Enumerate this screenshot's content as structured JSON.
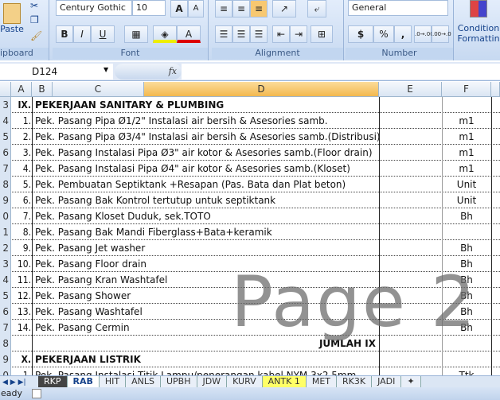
{
  "ribbon": {
    "clipboard": {
      "paste": "Paste",
      "label": "ipboard"
    },
    "font": {
      "name": "Century Gothic",
      "size": "10",
      "bold": "B",
      "italic": "I",
      "underline": "U",
      "grow": "A",
      "shrink": "A",
      "color": "A",
      "label": "Font"
    },
    "alignment": {
      "label": "Alignment"
    },
    "number": {
      "format": "General",
      "currency": "$",
      "percent": "%",
      "comma": ",",
      "inc": ".0→.00",
      "dec": ".00→.0",
      "label": "Number"
    },
    "styles": {
      "conditional": "Condition",
      "formatting": "Formattin"
    }
  },
  "formula_bar": {
    "name_box": "D124",
    "fx": "fx",
    "value": ""
  },
  "columns": [
    "A",
    "B",
    "C",
    "D",
    "E",
    "F"
  ],
  "rows": [
    {
      "rn": "3",
      "num": "IX.",
      "text": "PEKERJAAN SANITARY & PLUMBING",
      "unit": "",
      "bold": true
    },
    {
      "rn": "4",
      "num": "1.",
      "text": "Pek. Pasang Pipa Ø1/2\" Instalasi air bersih & Asesories samb.",
      "unit": "m1"
    },
    {
      "rn": "5",
      "num": "2.",
      "text": "Pek. Pasang Pipa Ø3/4\" Instalasi air bersih & Asesories samb.(Distribusi)",
      "unit": "m1"
    },
    {
      "rn": "6",
      "num": "3.",
      "text": "Pek. Pasang  Instalasi Pipa Ø3\" air kotor & Asesories samb.(Floor drain)",
      "unit": "m1"
    },
    {
      "rn": "7",
      "num": "4.",
      "text": "Pek. Pasang  Instalasi Pipa Ø4\" air kotor & Asesories samb.(Kloset)",
      "unit": "m1"
    },
    {
      "rn": "8",
      "num": "5.",
      "text": "Pek. Pembuatan Septiktank +Resapan (Pas. Bata dan Plat beton)",
      "unit": "Unit"
    },
    {
      "rn": "9",
      "num": "6.",
      "text": "Pek. Pasang  Bak Kontrol tertutup untuk septiktank",
      "unit": "Unit"
    },
    {
      "rn": "0",
      "num": "7.",
      "text": "Pek. Pasang Kloset Duduk, sek.TOTO",
      "unit": "Bh"
    },
    {
      "rn": "1",
      "num": "8.",
      "text": "Pek. Pasang  Bak Mandi Fiberglass+Bata+keramik",
      "unit": ""
    },
    {
      "rn": "2",
      "num": "9.",
      "text": "Pek. Pasang Jet washer",
      "unit": "Bh"
    },
    {
      "rn": "3",
      "num": "10.",
      "text": "Pek. Pasang Floor drain",
      "unit": "Bh"
    },
    {
      "rn": "4",
      "num": "11.",
      "text": "Pek. Pasang Kran Washtafel",
      "unit": "Bh"
    },
    {
      "rn": "5",
      "num": "12.",
      "text": "Pek. Pasang Shower",
      "unit": "Bh"
    },
    {
      "rn": "6",
      "num": "13.",
      "text": "Pek. Pasang Washtafel",
      "unit": "Bh"
    },
    {
      "rn": "7",
      "num": "14.",
      "text": "Pek. Pasang Cermin",
      "unit": "Bh"
    },
    {
      "rn": "8",
      "num": "",
      "text": "JUMLAH IX",
      "unit": "",
      "total": true
    },
    {
      "rn": "9",
      "num": "X.",
      "text": "PEKERJAAN LISTRIK",
      "unit": "",
      "bold": true
    },
    {
      "rn": "0",
      "num": "1.",
      "text": "Pek. Pasang Instalasi Titik Lampu/penerangan kabel NYM 3x2.5mm",
      "unit": "Ttk"
    }
  ],
  "watermark": "Page 2",
  "sheet_tabs": [
    "RKP",
    "RAB",
    "HIT",
    "ANLS",
    "UPBH",
    "JDW",
    "KURV",
    "ANTK 1",
    "MET",
    "RK3K",
    "JADI"
  ],
  "active_tab": "RAB",
  "status": "eady",
  "colors": {
    "selected_col": "#f8c870",
    "tab_highlight": "#ffff66",
    "tab_dark": "#444444"
  }
}
